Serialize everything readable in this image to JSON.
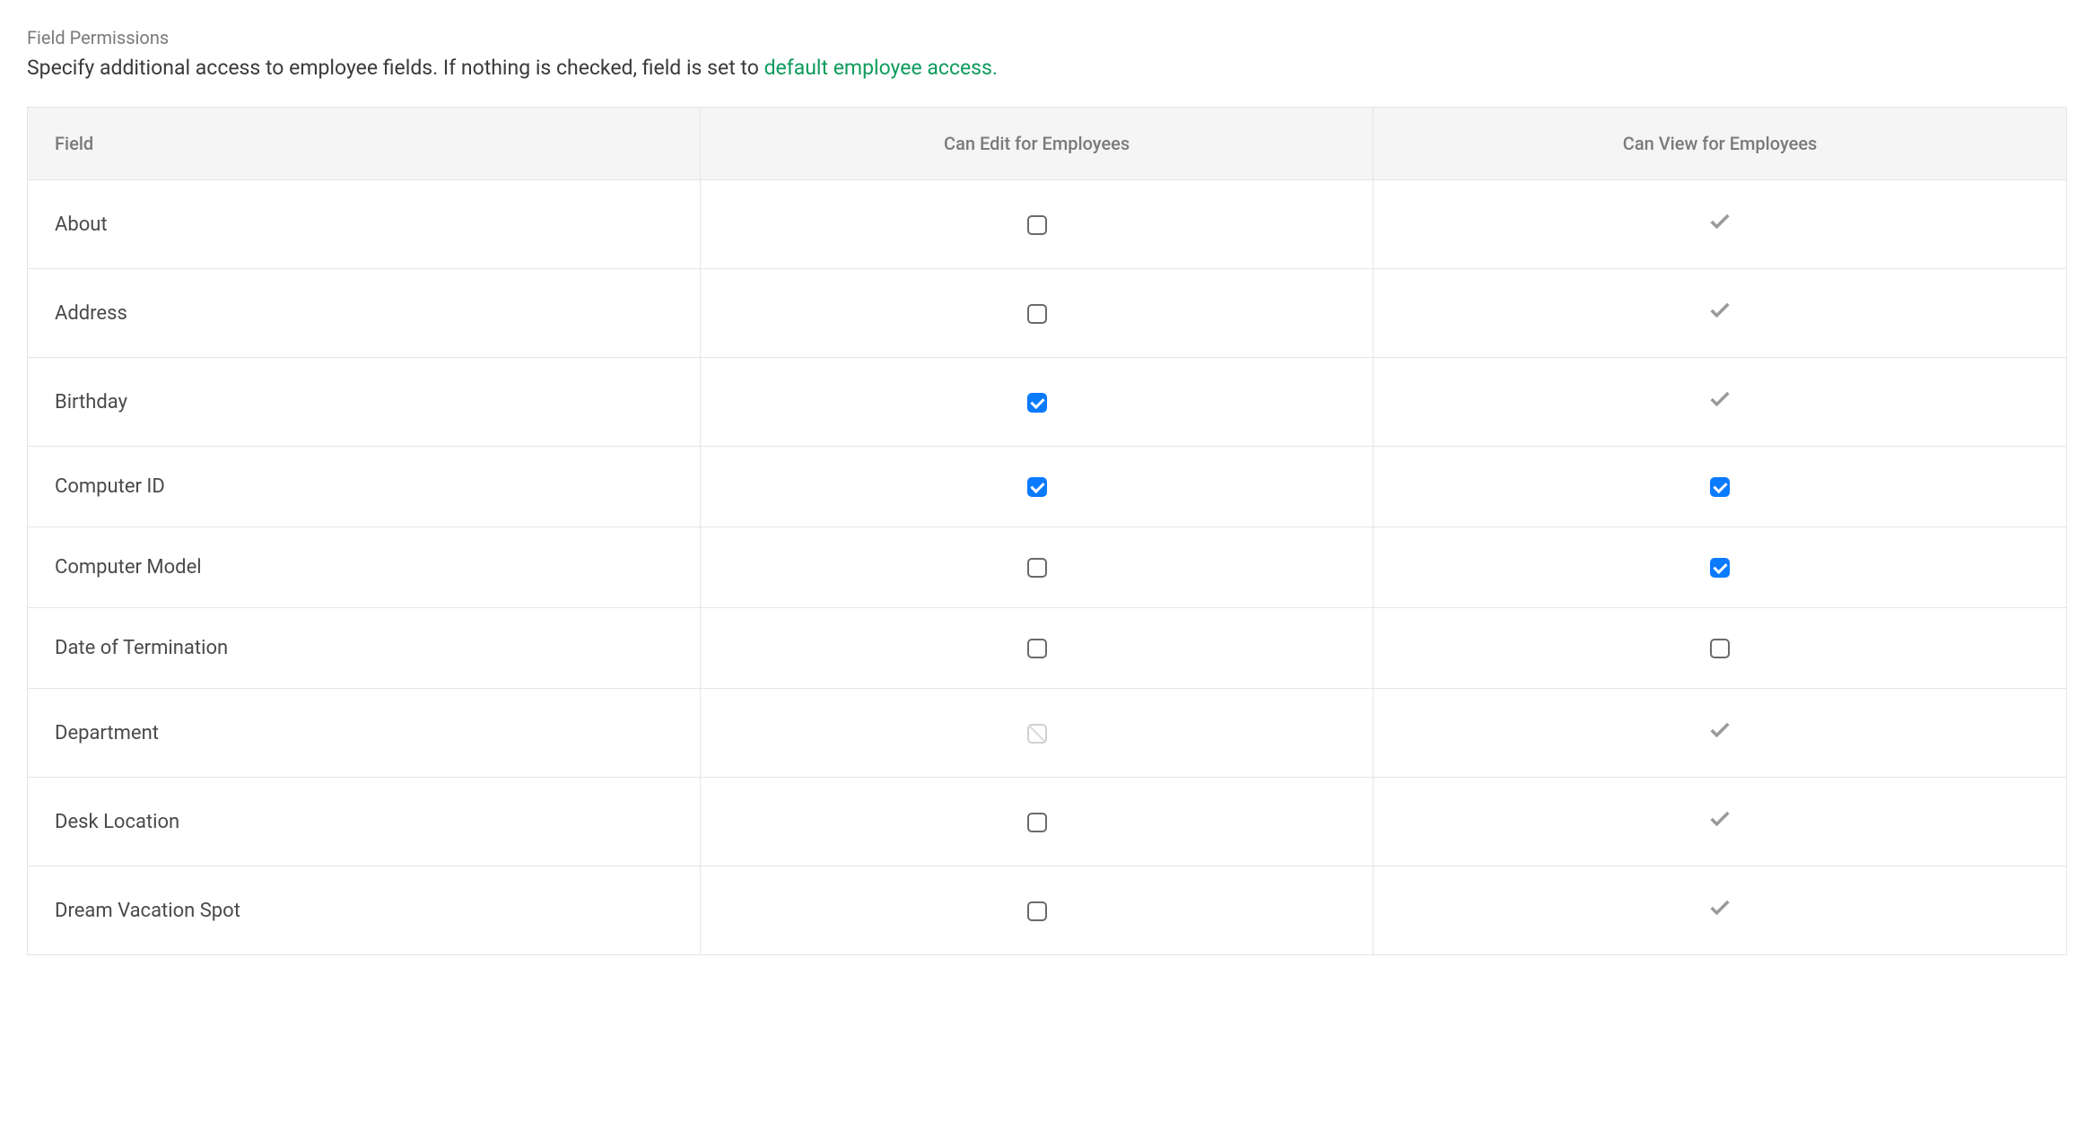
{
  "header": {
    "section_label": "Field Permissions",
    "description_text": "Specify additional access to employee fields. If nothing is checked, field is set to ",
    "description_link": "default employee access."
  },
  "table": {
    "headers": {
      "field": "Field",
      "edit": "Can Edit for Employees",
      "view": "Can View for Employees"
    },
    "rows": [
      {
        "field": "About",
        "edit": "unchecked",
        "view": "check-icon"
      },
      {
        "field": "Address",
        "edit": "unchecked",
        "view": "check-icon"
      },
      {
        "field": "Birthday",
        "edit": "checked",
        "view": "check-icon"
      },
      {
        "field": "Computer ID",
        "edit": "checked",
        "view": "checked"
      },
      {
        "field": "Computer Model",
        "edit": "unchecked",
        "view": "checked"
      },
      {
        "field": "Date of Termination",
        "edit": "unchecked",
        "view": "unchecked"
      },
      {
        "field": "Department",
        "edit": "disabled",
        "view": "check-icon"
      },
      {
        "field": "Desk Location",
        "edit": "unchecked",
        "view": "check-icon"
      },
      {
        "field": "Dream Vacation Spot",
        "edit": "unchecked",
        "view": "check-icon"
      }
    ]
  }
}
